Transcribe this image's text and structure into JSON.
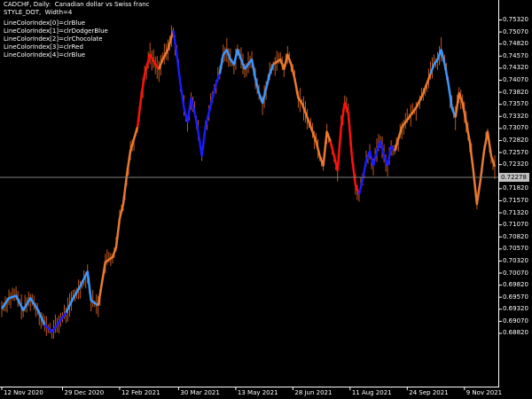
{
  "header": {
    "symbol_line": "CADCHF, Daily:  Canadian dollar vs Swiss franc",
    "style_line": "STYLE_DOT,  Width=4"
  },
  "legend": [
    "LineColorIndex[0]=clrBlue",
    "LineColorIndex[1]=clrDodgerBlue",
    "LineColorIndex[2]=clrChocolate",
    "LineColorIndex[3]=clrRed",
    "LineColorIndex[4]=clrBlue"
  ],
  "colors": {
    "background": "#000000",
    "axis": "#ffffff",
    "bars": "#c0581a",
    "blue": "#1a1aff",
    "dodgerblue": "#3c96ff",
    "chocolate": "#e87a30",
    "red": "#ff1010",
    "current_price_line": "#808080"
  },
  "current_price": "0.72278",
  "chart_data": {
    "type": "line",
    "ylim": [
      0.6779,
      0.7566
    ],
    "y_ticks": [
      "0.75320",
      "0.75070",
      "0.74820",
      "0.74570",
      "0.74320",
      "0.74070",
      "0.73820",
      "0.73570",
      "0.73320",
      "0.73070",
      "0.72820",
      "0.72570",
      "0.72320",
      "0.72070",
      "0.71820",
      "0.71570",
      "0.71320",
      "0.71070",
      "0.70820",
      "0.70570",
      "0.70320",
      "0.70070",
      "0.69820",
      "0.69570",
      "0.69320",
      "0.69070",
      "0.68820"
    ],
    "x_ticks": [
      {
        "label": "12 Nov 2020",
        "index": 0
      },
      {
        "label": "29 Dec 2020",
        "index": 34
      },
      {
        "label": "12 Feb 2021",
        "index": 66
      },
      {
        "label": "30 Mar 2021",
        "index": 99
      },
      {
        "label": "13 May 2021",
        "index": 131
      },
      {
        "label": "28 Jun 2021",
        "index": 163
      },
      {
        "label": "11 Aug 2021",
        "index": 195
      },
      {
        "label": "24 Sep 2021",
        "index": 227
      },
      {
        "label": "9 Nov 2021",
        "index": 259
      }
    ],
    "series": [
      {
        "color_index": 1,
        "points": [
          [
            0,
            0.6933
          ],
          [
            4,
            0.6955
          ],
          [
            8,
            0.696
          ],
          [
            12,
            0.693
          ],
          [
            16,
            0.6955
          ],
          [
            20,
            0.6932
          ],
          [
            24,
            0.69
          ]
        ]
      },
      {
        "color_index": 0,
        "points": [
          [
            24,
            0.69
          ],
          [
            28,
            0.6885
          ],
          [
            32,
            0.6905
          ],
          [
            36,
            0.6925
          ]
        ]
      },
      {
        "color_index": 1,
        "points": [
          [
            36,
            0.6925
          ],
          [
            40,
            0.6955
          ],
          [
            44,
            0.698
          ],
          [
            48,
            0.701
          ],
          [
            50,
            0.695
          ],
          [
            54,
            0.694
          ]
        ]
      },
      {
        "color_index": 2,
        "points": [
          [
            54,
            0.694
          ],
          [
            58,
            0.703
          ],
          [
            62,
            0.704
          ],
          [
            64,
            0.706
          ],
          [
            66,
            0.712
          ],
          [
            68,
            0.715
          ],
          [
            70,
            0.721
          ],
          [
            72,
            0.726
          ],
          [
            76,
            0.731
          ]
        ]
      },
      {
        "color_index": 3,
        "points": [
          [
            76,
            0.731
          ],
          [
            78,
            0.737
          ],
          [
            80,
            0.742
          ],
          [
            83,
            0.746
          ],
          [
            86,
            0.744
          ],
          [
            88,
            0.743
          ]
        ]
      },
      {
        "color_index": 2,
        "points": [
          [
            88,
            0.743
          ],
          [
            90,
            0.745
          ],
          [
            93,
            0.747
          ],
          [
            96,
            0.751
          ]
        ]
      },
      {
        "color_index": 0,
        "points": [
          [
            96,
            0.751
          ],
          [
            98,
            0.746
          ],
          [
            100,
            0.74
          ],
          [
            102,
            0.735
          ],
          [
            104,
            0.732
          ],
          [
            106,
            0.737
          ],
          [
            108,
            0.734
          ],
          [
            110,
            0.73
          ],
          [
            112,
            0.725
          ],
          [
            114,
            0.731
          ],
          [
            116,
            0.734
          ],
          [
            118,
            0.737
          ],
          [
            120,
            0.74
          ],
          [
            122,
            0.742
          ]
        ]
      },
      {
        "color_index": 1,
        "points": [
          [
            122,
            0.742
          ],
          [
            124,
            0.746
          ],
          [
            126,
            0.747
          ],
          [
            128,
            0.745
          ],
          [
            130,
            0.744
          ],
          [
            132,
            0.747
          ],
          [
            134,
            0.745
          ],
          [
            136,
            0.743
          ]
        ]
      },
      {
        "color_index": 1,
        "points": [
          [
            136,
            0.743
          ],
          [
            138,
            0.744
          ],
          [
            140,
            0.745
          ],
          [
            142,
            0.741
          ],
          [
            144,
            0.738
          ],
          [
            146,
            0.736
          ],
          [
            148,
            0.739
          ],
          [
            150,
            0.742
          ],
          [
            152,
            0.744
          ]
        ]
      },
      {
        "color_index": 2,
        "points": [
          [
            152,
            0.744
          ],
          [
            156,
            0.745
          ],
          [
            158,
            0.743
          ],
          [
            160,
            0.746
          ],
          [
            162,
            0.744
          ],
          [
            164,
            0.741
          ],
          [
            166,
            0.737
          ],
          [
            168,
            0.736
          ]
        ]
      },
      {
        "color_index": 2,
        "points": [
          [
            168,
            0.736
          ],
          [
            170,
            0.734
          ],
          [
            172,
            0.732
          ],
          [
            174,
            0.73
          ],
          [
            176,
            0.728
          ],
          [
            178,
            0.725
          ],
          [
            180,
            0.723
          ],
          [
            182,
            0.73
          ],
          [
            184,
            0.728
          ]
        ]
      },
      {
        "color_index": 3,
        "points": [
          [
            184,
            0.728
          ],
          [
            186,
            0.725
          ],
          [
            188,
            0.722
          ],
          [
            190,
            0.731
          ],
          [
            192,
            0.736
          ],
          [
            194,
            0.734
          ],
          [
            196,
            0.725
          ],
          [
            198,
            0.719
          ],
          [
            200,
            0.717
          ]
        ]
      },
      {
        "color_index": 0,
        "points": [
          [
            200,
            0.717
          ],
          [
            202,
            0.72
          ],
          [
            204,
            0.724
          ],
          [
            206,
            0.726
          ],
          [
            208,
            0.723
          ],
          [
            210,
            0.726
          ],
          [
            212,
            0.728
          ],
          [
            214,
            0.725
          ],
          [
            216,
            0.723
          ],
          [
            218,
            0.727
          ],
          [
            220,
            0.726
          ]
        ]
      },
      {
        "color_index": 2,
        "points": [
          [
            220,
            0.726
          ],
          [
            224,
            0.731
          ],
          [
            228,
            0.733
          ],
          [
            232,
            0.735
          ],
          [
            236,
            0.738
          ],
          [
            240,
            0.742
          ]
        ]
      },
      {
        "color_index": 1,
        "points": [
          [
            240,
            0.742
          ],
          [
            242,
            0.744
          ],
          [
            244,
            0.745
          ],
          [
            246,
            0.747
          ],
          [
            248,
            0.744
          ],
          [
            250,
            0.74
          ],
          [
            252,
            0.735
          ],
          [
            254,
            0.733
          ]
        ]
      },
      {
        "color_index": 2,
        "points": [
          [
            254,
            0.733
          ],
          [
            256,
            0.738
          ],
          [
            258,
            0.736
          ],
          [
            260,
            0.732
          ],
          [
            262,
            0.728
          ],
          [
            264,
            0.722
          ],
          [
            266,
            0.715
          ],
          [
            268,
            0.72
          ],
          [
            270,
            0.726
          ],
          [
            272,
            0.73
          ],
          [
            274,
            0.725
          ],
          [
            276,
            0.7228
          ]
        ]
      }
    ]
  }
}
